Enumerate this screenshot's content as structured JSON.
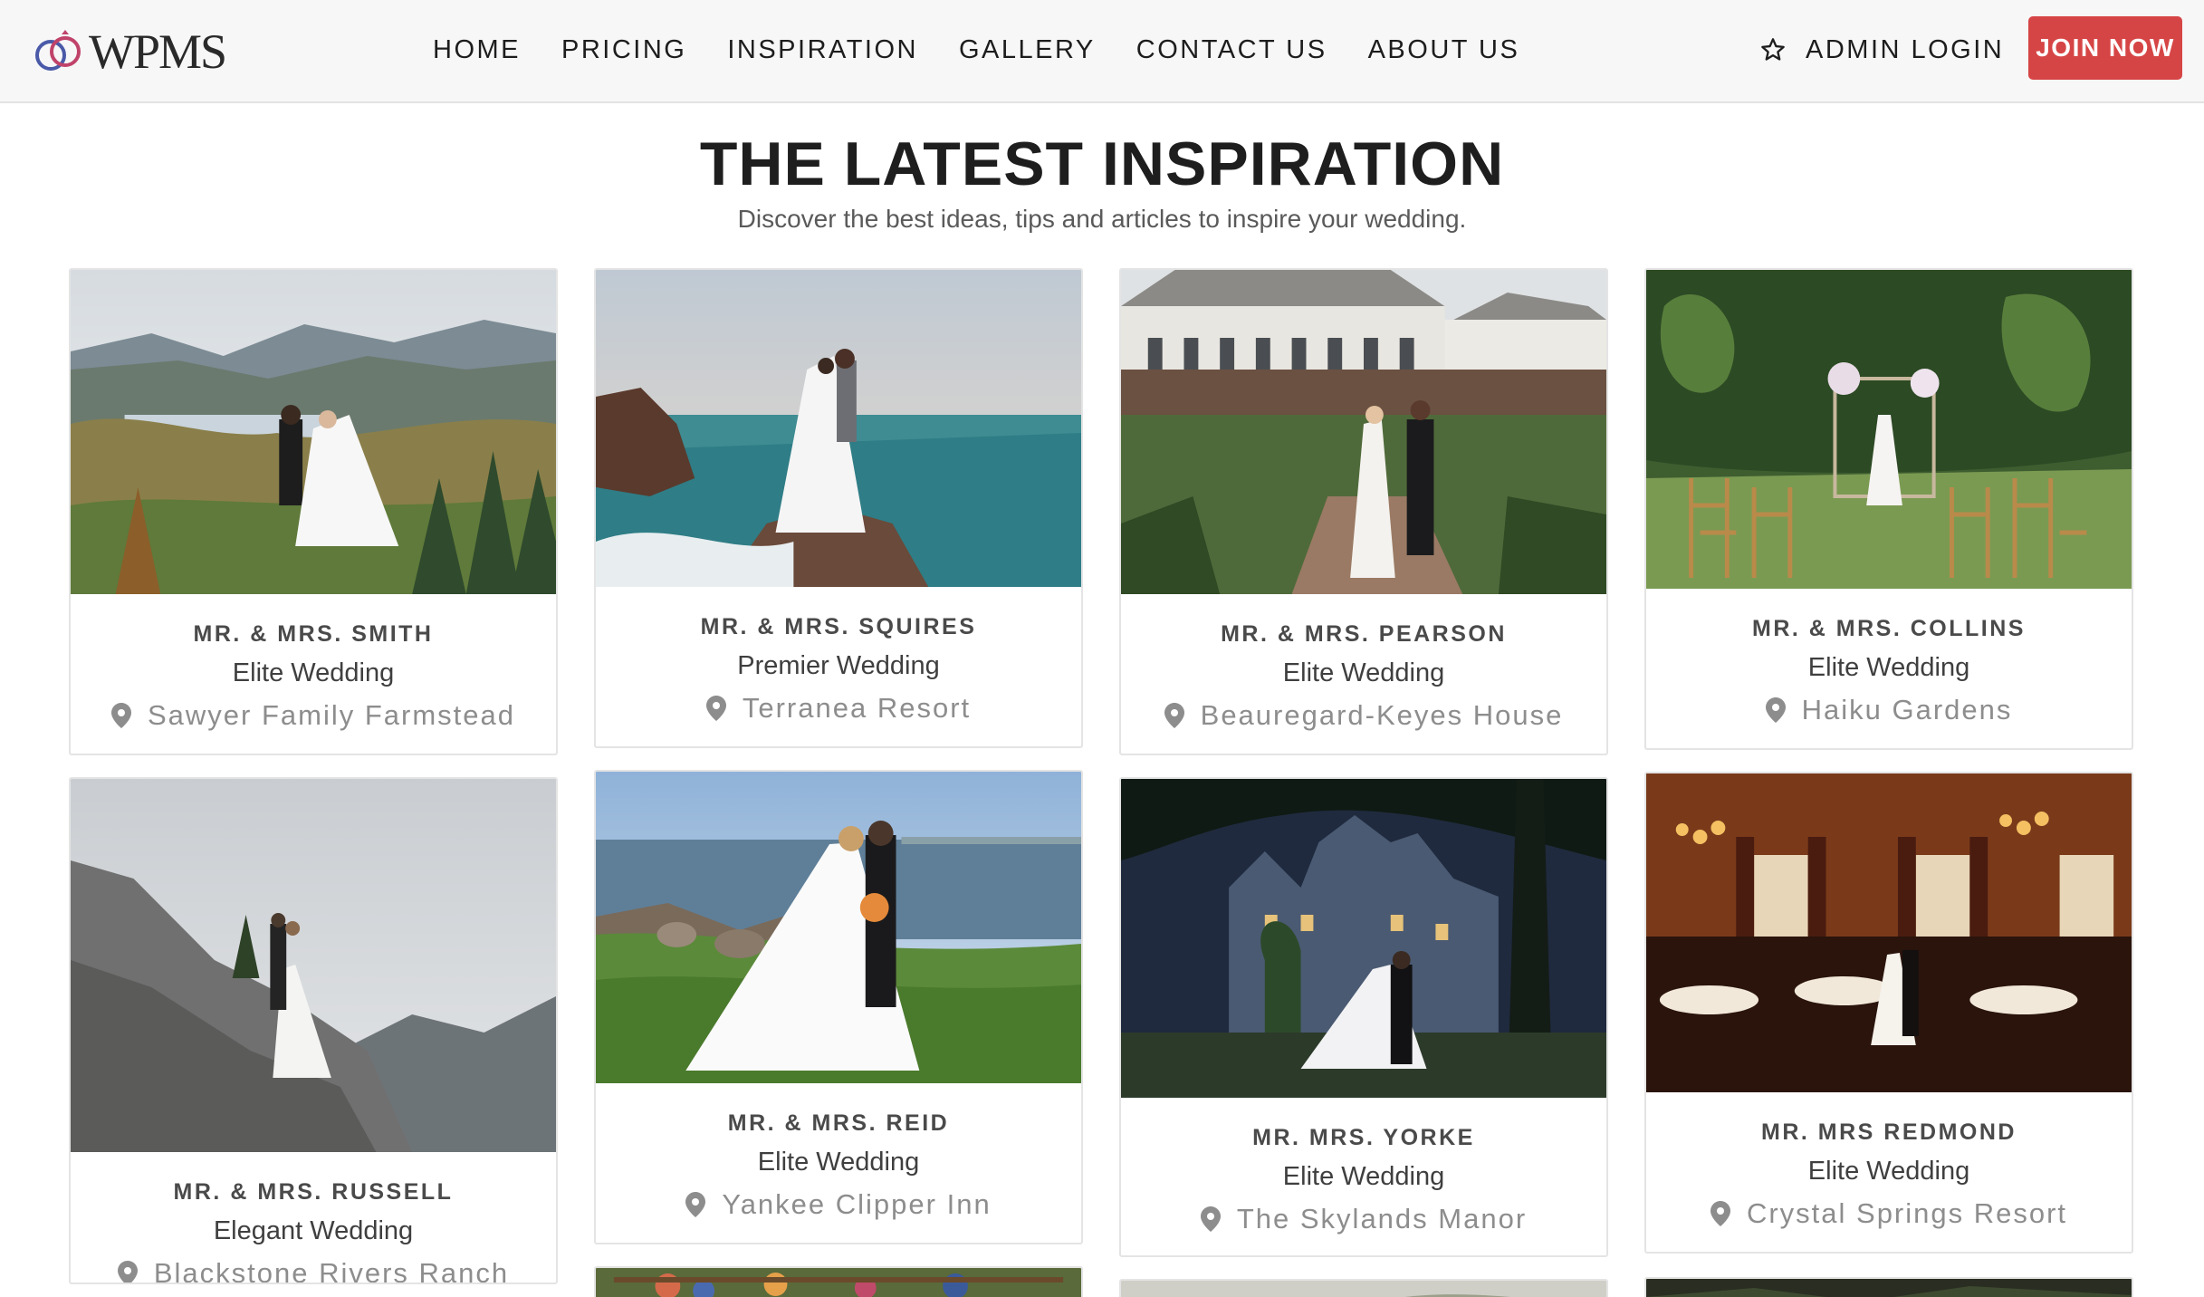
{
  "brand": {
    "logo_text": "WPMS"
  },
  "nav": {
    "items": [
      "HOME",
      "PRICING",
      "INSPIRATION",
      "GALLERY",
      "CONTACT US",
      "ABOUT US"
    ],
    "admin_label": "ADMIN LOGIN",
    "join_label": "JOIN NOW",
    "join_color": "#d64545"
  },
  "hero": {
    "title": "THE LATEST INSPIRATION",
    "subtitle": "Discover the best ideas, tips and articles to inspire your wedding."
  },
  "cards": [
    {
      "couple": "MR. & MRS. SMITH",
      "package": "Elite Wedding",
      "venue": "Sawyer Family Farmstead"
    },
    {
      "couple": "MR. & MRS. SQUIRES",
      "package": "Premier Wedding",
      "venue": "Terranea Resort"
    },
    {
      "couple": "MR. & MRS. PEARSON",
      "package": "Elite Wedding",
      "venue": "Beauregard-Keyes House"
    },
    {
      "couple": "MR. & MRS. COLLINS",
      "package": "Elite Wedding",
      "venue": "Haiku Gardens"
    },
    {
      "couple": "MR. & MRS. RUSSELL",
      "package": "Elegant Wedding",
      "venue": "Blackstone Rivers Ranch"
    },
    {
      "couple": "MR. & MRS. REID",
      "package": "Elite Wedding",
      "venue": "Yankee Clipper Inn"
    },
    {
      "couple": "MR. MRS. YORKE",
      "package": "Elite Wedding",
      "venue": "The Skylands Manor"
    },
    {
      "couple": "MR. MRS REDMOND",
      "package": "Elite Wedding",
      "venue": "Crystal Springs Resort"
    }
  ]
}
